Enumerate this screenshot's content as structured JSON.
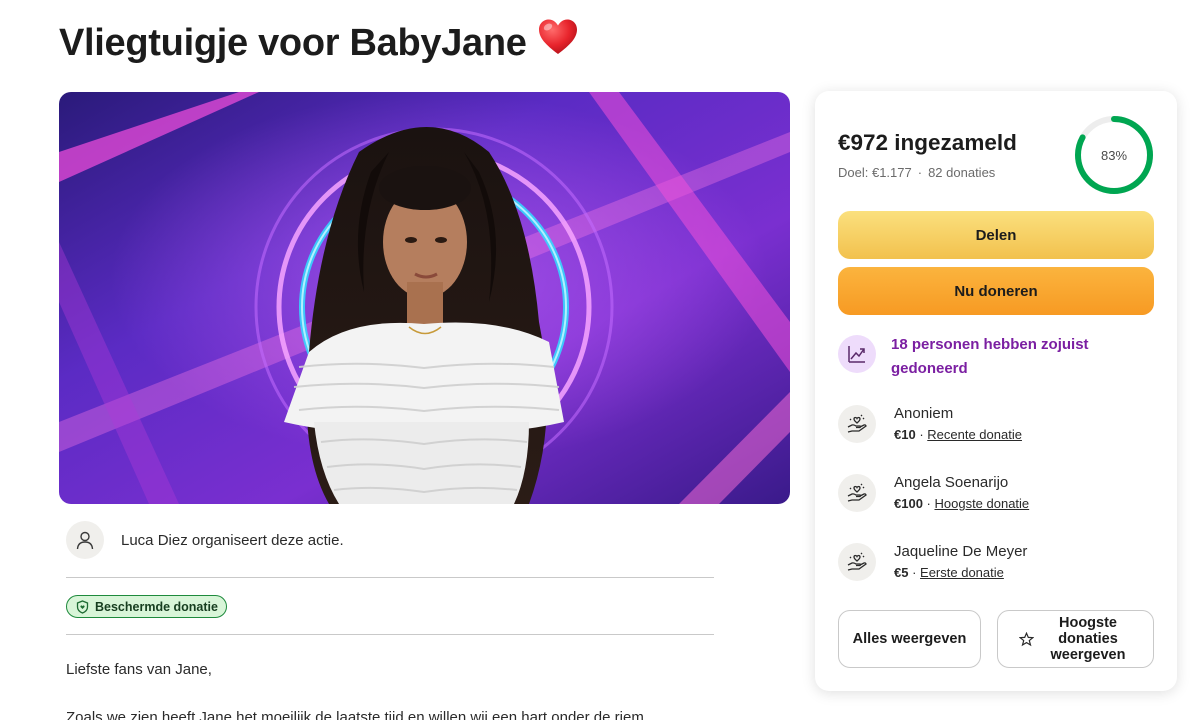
{
  "page": {
    "title": "Vliegtuigje voor BabyJane",
    "title_emoji": "heart-emoji",
    "accent_color": "#00a651"
  },
  "organizer": {
    "text": "Luca Diez organiseert deze actie.",
    "avatar_icon": "user-icon"
  },
  "badge": {
    "label": "Beschermde donatie",
    "icon": "shield-icon"
  },
  "story": {
    "paragraphs": [
      "Liefste fans van Jane,",
      "Zoals we zien heeft Jane het moeilijk de laatste tijd en willen wij een hart onder de riem"
    ]
  },
  "donation_card": {
    "raised": "€972 ingezameld",
    "goal": "Doel: €1.177",
    "separator": "·",
    "donation_count": "82 donaties",
    "progress_percent": 83,
    "progress_label": "83%",
    "share_button": "Delen",
    "donate_button": "Nu doneren",
    "trend_text": "18 personen hebben zojuist gedoneerd",
    "trend_icon": "trending-up-icon",
    "donors": [
      {
        "name": "Anoniem",
        "amount": "€10",
        "sep": " · ",
        "tag": "Recente donatie"
      },
      {
        "name": "Angela Soenarijo",
        "amount": "€100",
        "sep": " · ",
        "tag": "Hoogste donatie"
      },
      {
        "name": "Jaqueline De Meyer",
        "amount": "€5",
        "sep": " · ",
        "tag": "Eerste donatie"
      }
    ],
    "show_all_button": "Alles weergeven",
    "show_top_button": "Hoogste donaties weergeven"
  },
  "colors": {
    "progress_ring": "#00a651",
    "share_button": "#f5c654",
    "donate_button": "#f8a22c",
    "trend_text": "#7b1fa2",
    "badge_bg": "#d8f5d8"
  }
}
